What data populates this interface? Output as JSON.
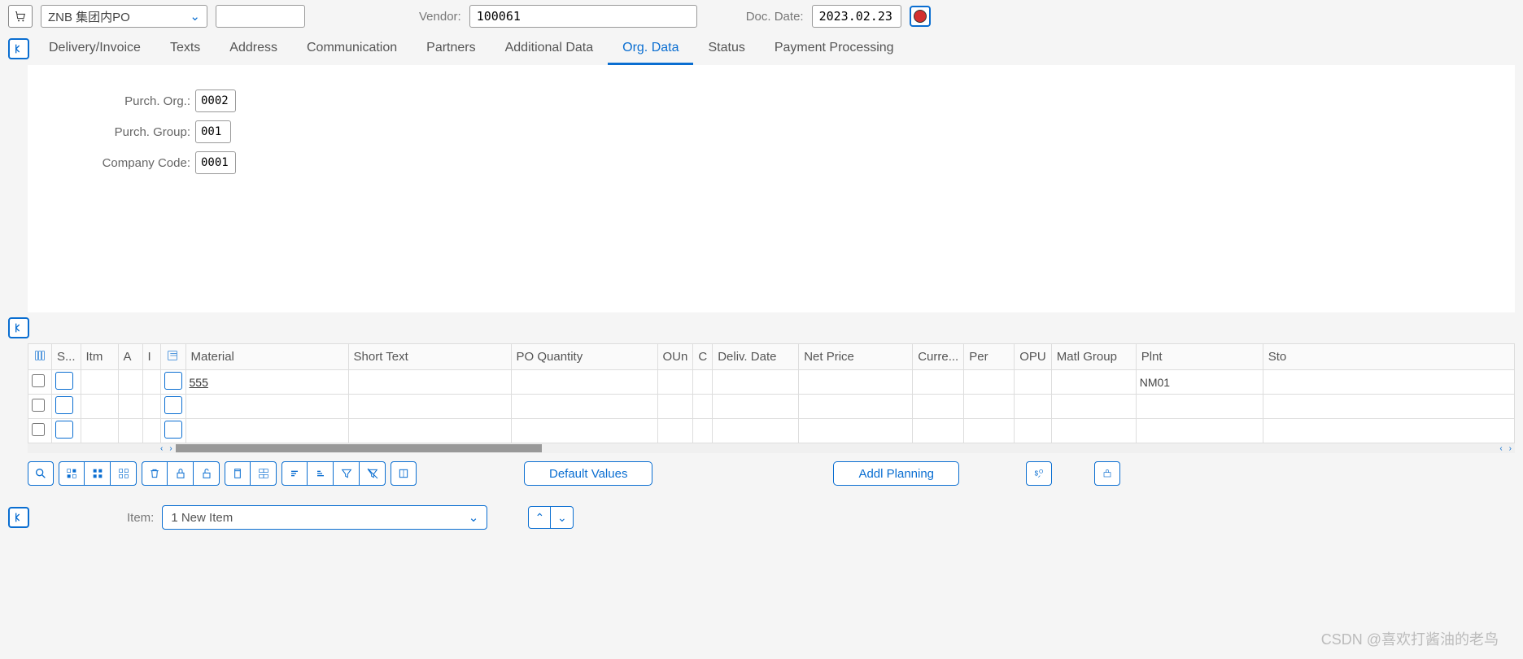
{
  "header": {
    "po_type": "ZNB 集团内PO",
    "po_number": "",
    "vendor_label": "Vendor:",
    "vendor_value": "100061",
    "doc_date_label": "Doc. Date:",
    "doc_date_value": "2023.02.23"
  },
  "tabs": [
    {
      "label": "Delivery/Invoice"
    },
    {
      "label": "Texts"
    },
    {
      "label": "Address"
    },
    {
      "label": "Communication"
    },
    {
      "label": "Partners"
    },
    {
      "label": "Additional Data"
    },
    {
      "label": "Org. Data",
      "active": true
    },
    {
      "label": "Status"
    },
    {
      "label": "Payment Processing"
    }
  ],
  "org_data": {
    "purch_org_label": "Purch. Org.:",
    "purch_org_value": "0002",
    "purch_group_label": "Purch. Group:",
    "purch_group_value": "001",
    "company_code_label": "Company Code:",
    "company_code_value": "0001"
  },
  "items_grid": {
    "columns": [
      "S...",
      "Itm",
      "A",
      "I",
      "",
      "Material",
      "Short Text",
      "PO Quantity",
      "OUn",
      "C",
      "Deliv. Date",
      "Net Price",
      "Curre...",
      "Per",
      "OPU",
      "Matl Group",
      "Plnt",
      "Sto"
    ],
    "rows": [
      {
        "material": "555",
        "plnt": "NM01"
      },
      {
        "material": "",
        "plnt": ""
      },
      {
        "material": "",
        "plnt": ""
      }
    ]
  },
  "toolbar_mid": {
    "default_values": "Default Values",
    "addl_planning": "Addl Planning"
  },
  "item_detail": {
    "item_label": "Item:",
    "item_value": "1 New Item"
  },
  "watermark": "CSDN @喜欢打酱油的老鸟"
}
